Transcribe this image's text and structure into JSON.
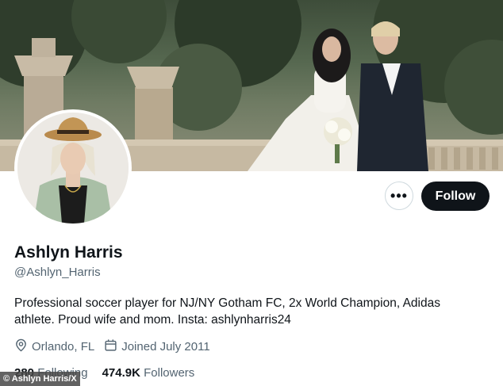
{
  "profile": {
    "display_name": "Ashlyn Harris",
    "handle": "@Ashlyn_Harris",
    "bio": "Professional soccer player for NJ/NY Gotham FC, 2x World Champion, Adidas athlete. Proud wife and mom. Insta: ashlynharris24",
    "location": "Orlando, FL",
    "joined": "Joined July 2011"
  },
  "actions": {
    "more_label": "•••",
    "follow_label": "Follow"
  },
  "stats": {
    "following_count": "280",
    "following_label": "Following",
    "followers_count": "474.9K",
    "followers_label": "Followers"
  },
  "icons": {
    "location": "location-pin-icon",
    "calendar": "calendar-icon"
  },
  "watermark": "© Ashlyn Harris/X",
  "colors": {
    "text_primary": "#0f1419",
    "text_secondary": "#536471",
    "follow_bg": "#0f1419",
    "border": "#cfd9de"
  }
}
